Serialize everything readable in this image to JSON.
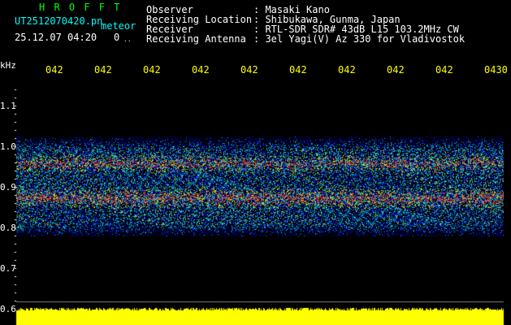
{
  "header": {
    "app_title": "H R O F F T",
    "file_name": "UT2512070420.pn",
    "file_tag": "meteor",
    "date_time": "25.12.07 04:20",
    "counter": "0",
    "counter_suffix": "..",
    "observer_label": "Observer",
    "observer_value": ": Masaki Kano",
    "location_label": "Receiving Location",
    "location_value": ": Shibukawa, Gunma, Japan",
    "receiver_label": "Receiver",
    "receiver_value": ": RTL-SDR SDR# 43dB L15 103.2MHz CW",
    "antenna_label": "Receiving Antenna",
    "antenna_value": ": 3el Yagi(V) Az 330 for Vladivostok"
  },
  "axis": {
    "unit": "kHz",
    "y_ticks": [
      "1.1",
      "1.0",
      "0.9",
      "0.8",
      "0.7",
      "0.6"
    ],
    "x_ticks": [
      "042",
      "042",
      "042",
      "042",
      "042",
      "042",
      "042",
      "042",
      "042",
      "0430"
    ]
  },
  "colors": {
    "background": "#000000",
    "text": "#ffffff",
    "title": "#00ff00",
    "tick_label": "#ffff00",
    "level_bar": "#ffff00"
  }
}
